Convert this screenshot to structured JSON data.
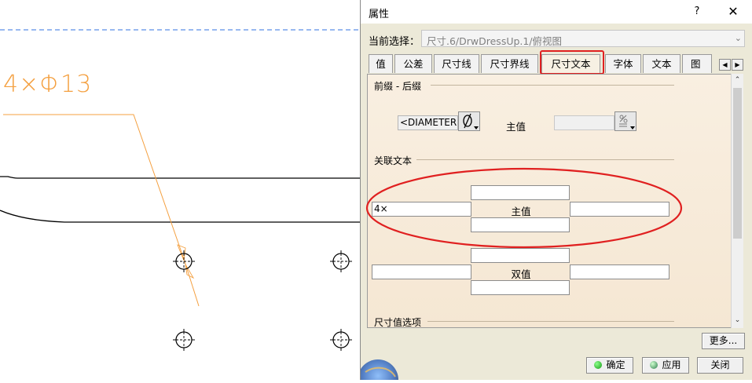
{
  "canvas": {
    "annotation_text": "4×Φ13"
  },
  "dialog": {
    "title": "属性",
    "help_label": "?",
    "close_label": "✕",
    "current_selection": {
      "label": "当前选择：",
      "value": "尺寸.6/DrwDressUp.1/俯视图"
    },
    "tabs": [
      {
        "label": "值"
      },
      {
        "label": "公差"
      },
      {
        "label": "尺寸线"
      },
      {
        "label": "尺寸界线"
      },
      {
        "label": "尺寸文本",
        "active": true
      },
      {
        "label": "字体"
      },
      {
        "label": "文本"
      },
      {
        "label": "图"
      }
    ],
    "prefix_suffix": {
      "heading": "前缀 - 后缀",
      "diameter_field": "<DIAMETER",
      "main_value_label": "主值"
    },
    "associated_text": {
      "heading": "关联文本",
      "main_row_left_value": "4×",
      "main_value_label": "主值",
      "dual_value_label": "双值"
    },
    "dimension_value_options": {
      "heading": "尺寸值选项"
    },
    "buttons": {
      "more": "更多...",
      "ok": "确定",
      "apply": "应用",
      "close": "关闭"
    },
    "colors": {
      "annotation_orange": "#f4a040",
      "highlight_red": "#e02020",
      "led_green": "#22c022"
    }
  }
}
